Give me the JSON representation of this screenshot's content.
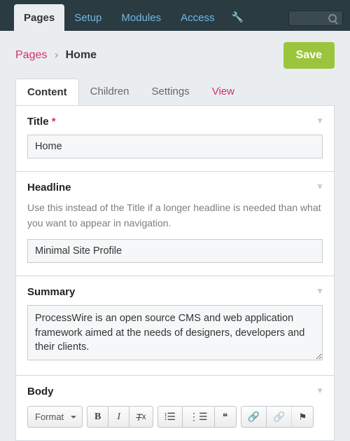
{
  "nav": {
    "items": [
      "Pages",
      "Setup",
      "Modules",
      "Access"
    ],
    "active_index": 0
  },
  "breadcrumb": {
    "root": "Pages",
    "current": "Home"
  },
  "actions": {
    "save_label": "Save"
  },
  "tabs": {
    "items": [
      "Content",
      "Children",
      "Settings",
      "View"
    ],
    "active_index": 0
  },
  "fields": {
    "title": {
      "label": "Title",
      "required_mark": "*",
      "value": "Home"
    },
    "headline": {
      "label": "Headline",
      "description": "Use this instead of the Title if a longer headline is needed than what you want to appear in navigation.",
      "value": "Minimal Site Profile"
    },
    "summary": {
      "label": "Summary",
      "value": "ProcessWire is an open source CMS and web application framework aimed at the needs of designers, developers and their clients."
    },
    "body": {
      "label": "Body",
      "format_label": "Format"
    }
  }
}
